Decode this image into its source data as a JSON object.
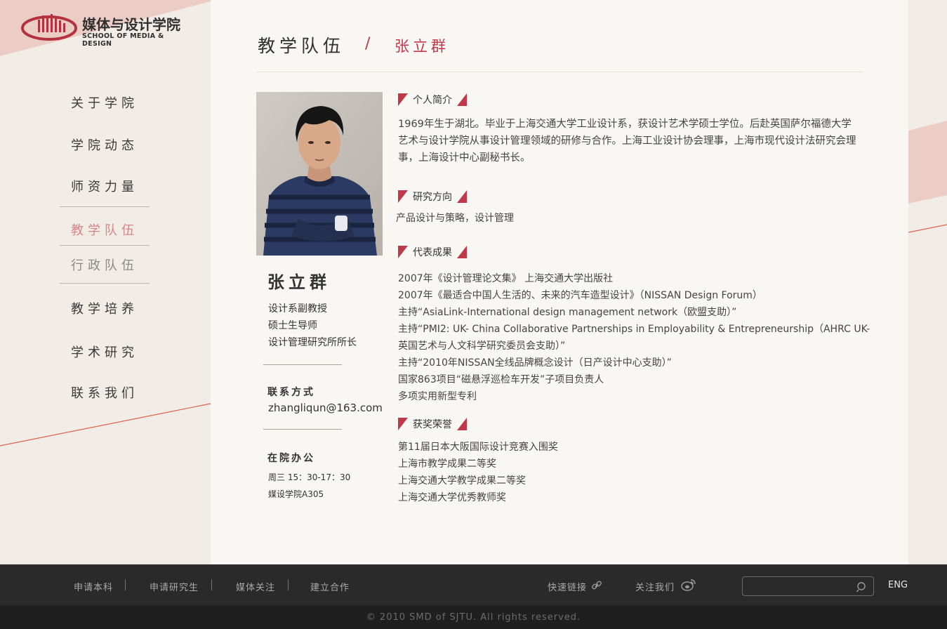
{
  "logo": {
    "cn": "媒体与设计学院",
    "en": "SCHOOL OF MEDIA & DESIGN"
  },
  "nav": {
    "items": [
      {
        "label": "关于学院"
      },
      {
        "label": "学院动态"
      },
      {
        "label": "师资力量"
      },
      {
        "label": "教学队伍"
      },
      {
        "label": "行政队伍"
      },
      {
        "label": "教学培养"
      },
      {
        "label": "学术研究"
      },
      {
        "label": "联系我们"
      }
    ]
  },
  "header": {
    "section": "教学队伍",
    "slash": "/",
    "current": "张立群"
  },
  "profile": {
    "name": "张立群",
    "titles": [
      "设计系副教授",
      "硕士生导师",
      "设计管理研究所所长"
    ],
    "contact_label": "联系方式",
    "email": "zhangliqun@163.com",
    "office_label": "在院办公",
    "office_hours": "周三 15：30-17：30",
    "office_room": "媒设学院A305"
  },
  "sections": {
    "intro": {
      "heading": "个人简介",
      "text": "1969年生于湖北。毕业于上海交通大学工业设计系，获设计艺术学硕士学位。后赴英国萨尔福德大学艺术与设计学院从事设计管理领域的研修与合作。上海工业设计协会理事，上海市现代设计法研究会理事，上海设计中心副秘书长。"
    },
    "research": {
      "heading": "研究方向",
      "text": "产品设计与策略，设计管理"
    },
    "works": {
      "heading": "代表成果",
      "lines": [
        "2007年《设计管理论文集》 上海交通大学出版社",
        "2007年《最适合中国人生活的、未来的汽车造型设计》（NISSAN Design Forum）",
        "主持“AsiaLink-International design management network（欧盟支助）”",
        "主持“PMI2: UK- China Collaborative Partnerships in Employability & Entrepreneurship（AHRC UK-",
        "英国艺术与人文科学研究委员会支助）”",
        "主持“2010年NISSAN全线品牌概念设计（日产设计中心支助）”",
        "国家863项目“磁悬浮巡检车开发”子项目负责人",
        "多项实用新型专利"
      ]
    },
    "awards": {
      "heading": "获奖荣誉",
      "lines": [
        "第11届日本大阪国际设计竞赛入围奖",
        "上海市教学成果二等奖",
        "上海交通大学教学成果二等奖",
        "上海交通大学优秀教师奖"
      ]
    }
  },
  "footer": {
    "links": [
      "申请本科",
      "申请研究生",
      "媒体关注",
      "建立合作"
    ],
    "quick_links": "快速链接",
    "follow_us": "关注我们",
    "search_placeholder": "",
    "lang": "ENG",
    "copyright": "© 2010 SMD of SJTU. All rights reserved."
  },
  "colors": {
    "accent": "#c0394a",
    "nav_active": "#d6848a",
    "pink_deco": "#ebcdc6",
    "footer_bg": "#2a2a2a"
  },
  "icons": {
    "quick_links": "link-icon",
    "follow_us": "weibo-icon",
    "search": "search-icon"
  }
}
